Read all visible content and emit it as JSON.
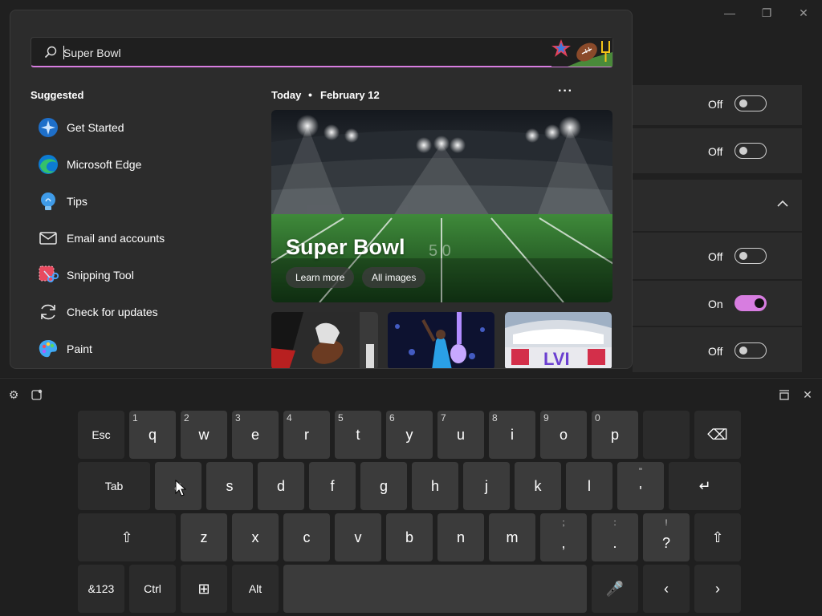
{
  "window": {
    "controls": {
      "minimize": "—",
      "maximize": "❐",
      "close": "✕"
    },
    "rows": [
      {
        "state": "Off",
        "on": false
      },
      {
        "state": "Off",
        "on": false
      },
      {
        "state": "Off",
        "on": false
      },
      {
        "state": "On",
        "on": true
      },
      {
        "state": "Off",
        "on": false
      }
    ],
    "accent": "#d77de0"
  },
  "search": {
    "query": "Super Bowl",
    "suggested_heading": "Suggested",
    "suggested": [
      {
        "label": "Get Started",
        "icon": "get-started-icon"
      },
      {
        "label": "Microsoft Edge",
        "icon": "edge-icon"
      },
      {
        "label": "Tips",
        "icon": "tips-lightbulb-icon"
      },
      {
        "label": "Email and accounts",
        "icon": "mail-icon"
      },
      {
        "label": "Snipping Tool",
        "icon": "snipping-tool-icon"
      },
      {
        "label": "Check for updates",
        "icon": "refresh-icon"
      },
      {
        "label": "Paint",
        "icon": "paint-icon"
      }
    ],
    "today_label": "Today",
    "date": "February 12",
    "more": "···",
    "hero": {
      "title": "Super Bowl",
      "learn_more": "Learn more",
      "all_images": "All images"
    }
  },
  "keyboard": {
    "rows": [
      [
        {
          "label": "Esc",
          "w": 58,
          "small": true,
          "dark": true
        },
        {
          "label": "q",
          "hint": "1"
        },
        {
          "label": "w",
          "hint": "2"
        },
        {
          "label": "e",
          "hint": "3"
        },
        {
          "label": "r",
          "hint": "4"
        },
        {
          "label": "t",
          "hint": "5"
        },
        {
          "label": "y",
          "hint": "6"
        },
        {
          "label": "u",
          "hint": "7"
        },
        {
          "label": "i",
          "hint": "8"
        },
        {
          "label": "o",
          "hint": "9"
        },
        {
          "label": "p",
          "hint": "0"
        },
        {
          "label": "",
          "w": 58,
          "dark": true
        },
        {
          "label": "⌫",
          "w": 58,
          "dark": true,
          "name": "backspace-key"
        }
      ],
      [
        {
          "label": "Tab",
          "w": 90,
          "small": true,
          "dark": true
        },
        {
          "label": "a"
        },
        {
          "label": "s"
        },
        {
          "label": "d"
        },
        {
          "label": "f"
        },
        {
          "label": "g"
        },
        {
          "label": "h"
        },
        {
          "label": "j"
        },
        {
          "label": "k"
        },
        {
          "label": "l"
        },
        {
          "label": "'",
          "chint": "\""
        },
        {
          "label": "↵",
          "w": 90,
          "dark": true,
          "name": "enter-key"
        }
      ],
      [
        {
          "label": "⇧",
          "w": 122,
          "dark": true,
          "name": "shift-left-key"
        },
        {
          "label": "z"
        },
        {
          "label": "x"
        },
        {
          "label": "c"
        },
        {
          "label": "v"
        },
        {
          "label": "b"
        },
        {
          "label": "n"
        },
        {
          "label": "m"
        },
        {
          "label": ",",
          "chint": ";"
        },
        {
          "label": ".",
          "chint": ":"
        },
        {
          "label": "?",
          "chint": "!"
        },
        {
          "label": "⇧",
          "w": 58,
          "dark": true,
          "name": "shift-right-key"
        }
      ],
      [
        {
          "label": "&123",
          "w": 58,
          "small": true,
          "dark": true
        },
        {
          "label": "Ctrl",
          "small": true,
          "dark": true
        },
        {
          "label": "⊞",
          "dark": true,
          "name": "windows-key"
        },
        {
          "label": "Alt",
          "small": true,
          "dark": true
        },
        {
          "label": "",
          "w": 378,
          "name": "space-key"
        },
        {
          "label": "🎤",
          "dark": true,
          "name": "microphone-key"
        },
        {
          "label": "‹",
          "dark": true,
          "name": "arrow-left-key"
        },
        {
          "label": "›",
          "dark": true,
          "name": "arrow-right-key"
        }
      ]
    ]
  }
}
